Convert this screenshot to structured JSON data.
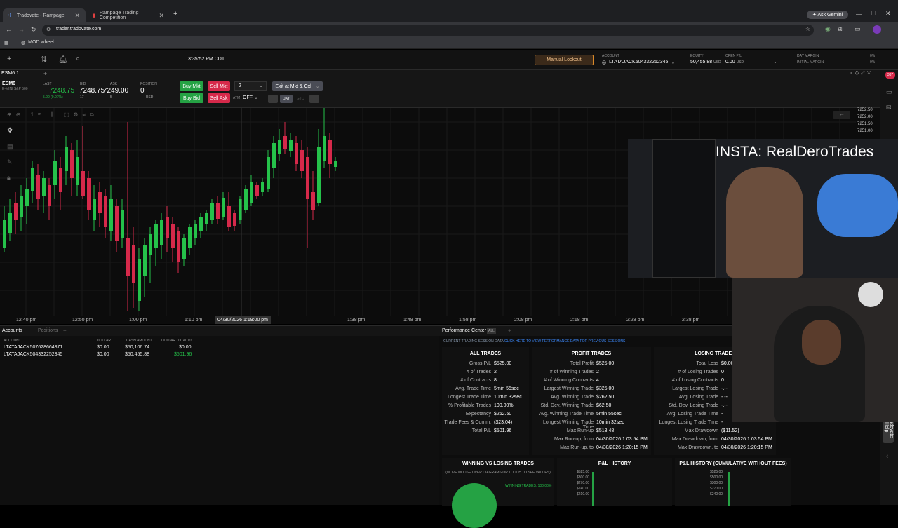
{
  "browser": {
    "tabs": [
      {
        "title": "Tradovate - Rampage",
        "active": true
      },
      {
        "title": "Rampage Trading Competition",
        "active": false
      }
    ],
    "ask_gemini": "Ask Gemini",
    "url": "trader.tradovate.com",
    "bookmark": "MOD wheel"
  },
  "app": {
    "clock": "3:35:52 PM CDT",
    "manual_lockout": "Manual Lockout",
    "account_label": "ACCOUNT",
    "account_value": "LTATAJACK504332252345",
    "equity_label": "EQUITY",
    "equity_value": "50,455.88",
    "equity_unit": "USD",
    "open_pl_label": "OPEN P/L",
    "open_pl_value": "0.00",
    "open_pl_unit": "USD",
    "day_margin_label": "DAY MARGIN",
    "day_margin_value": "0%",
    "initial_margin_label": "INITIAL MARGIN",
    "initial_margin_value": "0%"
  },
  "chart_tab": {
    "symbol": "ESM6",
    "interval": "1"
  },
  "quote": {
    "symbol": "ESM6",
    "description": "E-MINI S&P 500",
    "last_label": "LAST",
    "last": "7248.75",
    "last_change": "5.00 (0.07%)",
    "bid_label": "BID",
    "bid": "7248.75",
    "bid_size": "17",
    "ask_label": "ASK",
    "ask": "7249.00",
    "ask_size": "5",
    "position_label": "POSITION",
    "position": "0",
    "position_sub": "-.-- USD"
  },
  "order": {
    "buy_mkt": "Buy Mkt",
    "sell_mkt": "Sell Mkt",
    "qty": "2",
    "exit": "Exit at Mkt & Cxl",
    "buy_bid": "Buy Bid",
    "sell_ask": "Sell Ask",
    "atm_label": "ATM",
    "atm_value": "OFF",
    "day": "DAY",
    "gtc": "GTC"
  },
  "chart": {
    "price_labels": [
      "7252.50",
      "7252.00",
      "7251.50",
      "7251.00"
    ],
    "time_labels": [
      "12:40 pm",
      "12:50 pm",
      "1:00 pm",
      "1:10 pm",
      "1:38 pm",
      "1:48 pm",
      "1:58 pm",
      "2:08 pm",
      "2:18 pm",
      "2:28 pm",
      "2:38 pm"
    ],
    "crosshair_time": "04/30/2026 1:19:00 pm"
  },
  "accounts_panel": {
    "tabs": [
      "Accounts",
      "Positions"
    ],
    "headers": [
      "ACCOUNT",
      "DOLLAR",
      "CASH AMOUNT",
      "DOLLAR TOTAL P/L"
    ],
    "rows": [
      {
        "account": "LTATAJACK507628664371",
        "dollar": "$0.00",
        "cash": "$50,106.74",
        "pl": "$0.00"
      },
      {
        "account": "LTATAJACK504332252345",
        "dollar": "$0.00",
        "cash": "$50,455.88",
        "pl": "$501.96"
      }
    ]
  },
  "performance": {
    "title": "Performance Center",
    "all_chip": "ALL",
    "session_note": "CURRENT TRADING SESSION DATA",
    "session_link": "CLICK HERE TO VIEW PERFORMANCE DATA FOR PREVIOUS SESSIONS",
    "all_trades": {
      "title": "ALL TRADES",
      "stats": [
        {
          "label": "Gross P/L",
          "value": "$525.00"
        },
        {
          "label": "# of Trades",
          "value": "2"
        },
        {
          "label": "# of Contracts",
          "value": "8"
        },
        {
          "label": "Avg. Trade Time",
          "value": "5min 55sec"
        },
        {
          "label": "Longest Trade Time",
          "value": "10min 32sec"
        },
        {
          "label": "% Profitable Trades",
          "value": "100.00%"
        },
        {
          "label": "Expectancy",
          "value": "$262.50"
        },
        {
          "label": "Trade Fees & Comm.",
          "value": "($23.04)"
        },
        {
          "label": "Total P/L",
          "value": "$501.96"
        }
      ]
    },
    "profit_trades": {
      "title": "PROFIT TRADES",
      "stats": [
        {
          "label": "Total Profit",
          "value": "$525.00"
        },
        {
          "label": "# of Winning Trades",
          "value": "2"
        },
        {
          "label": "# of Winning Contracts",
          "value": "4"
        },
        {
          "label": "Largest Winning Trade",
          "value": "$325.00"
        },
        {
          "label": "Avg. Winning Trade",
          "value": "$262.50"
        },
        {
          "label": "Std. Dev. Winning Trade",
          "value": "$62.50"
        },
        {
          "label": "Avg. Winning Trade Time",
          "value": "5min 55sec"
        },
        {
          "label": "Longest Winning Trade Time",
          "value": "10min 32sec"
        },
        {
          "label": "Max Run-up",
          "value": "$513.48"
        },
        {
          "label": "Max Run-up, from",
          "value": "04/30/2026 1:03:54 PM"
        },
        {
          "label": "Max Run-up, to",
          "value": "04/30/2026 1:20:15 PM"
        }
      ]
    },
    "losing_trades": {
      "title": "LOSING TRADES",
      "stats": [
        {
          "label": "Total Loss",
          "value": "$0.00"
        },
        {
          "label": "# of Losing Trades",
          "value": "0"
        },
        {
          "label": "# of Losing Contracts",
          "value": "0"
        },
        {
          "label": "Largest Losing Trade",
          "value": "-.--"
        },
        {
          "label": "Avg. Losing Trade",
          "value": "-.--"
        },
        {
          "label": "Std. Dev. Losing Trade",
          "value": "-.--"
        },
        {
          "label": "Avg. Losing Trade Time",
          "value": "-"
        },
        {
          "label": "Longest Losing Trade Time",
          "value": "-"
        },
        {
          "label": "Max Drawdown",
          "value": "($11.52)"
        },
        {
          "label": "Max Drawdown, from",
          "value": "04/30/2026 1:03:54 PM"
        },
        {
          "label": "Max Drawdown, to",
          "value": "04/30/2026 1:20:15 PM"
        }
      ]
    },
    "bottom": {
      "wl_title": "WINNING VS LOSING TRADES",
      "wl_hint": "(MOVE MOUSE OVER DIAGRAMS OR TOUCH TO SEE VALUES)",
      "wl_legend": "WINNING TRADES: 100.00%",
      "pl_title": "P&L HISTORY",
      "pl_ticks": [
        "$525.00",
        "$300.00",
        "$270.00",
        "$240.00",
        "$210.00"
      ],
      "cum_title": "P&L HISTORY (CUMULATIVE WITHOUT FEES)",
      "cum_ticks": [
        "$525.00",
        "$500.00",
        "$300.00",
        "$270.00",
        "$240.00"
      ]
    }
  },
  "overlay": {
    "insta": "INSTA: RealDeroTrades",
    "help_tab": "Tradovate Help"
  },
  "colors": {
    "green": "#25a244",
    "red": "#d6294a",
    "accent_orange": "#d8892a",
    "link_blue": "#3d8bff"
  }
}
